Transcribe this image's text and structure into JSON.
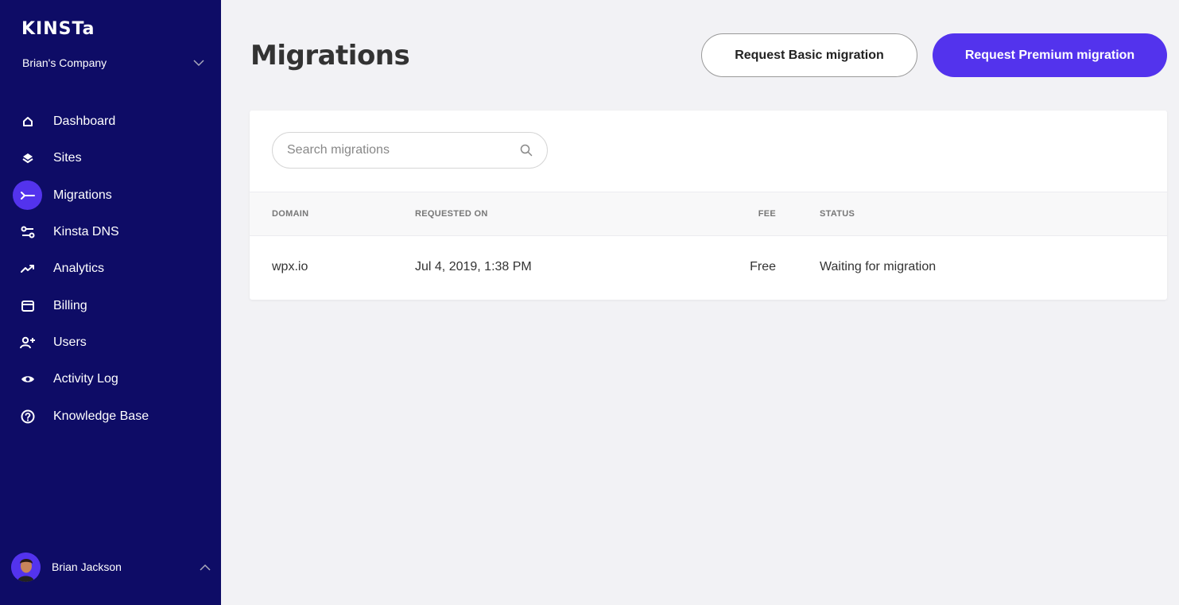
{
  "sidebar": {
    "logo": "KINSTa",
    "company": "Brian's Company",
    "items": [
      {
        "label": "Dashboard",
        "icon": "home-icon"
      },
      {
        "label": "Sites",
        "icon": "layers-icon"
      },
      {
        "label": "Migrations",
        "icon": "migration-icon",
        "active": true
      },
      {
        "label": "Kinsta DNS",
        "icon": "dns-icon"
      },
      {
        "label": "Analytics",
        "icon": "trend-icon"
      },
      {
        "label": "Billing",
        "icon": "card-icon"
      },
      {
        "label": "Users",
        "icon": "add-user-icon"
      },
      {
        "label": "Activity Log",
        "icon": "eye-icon"
      },
      {
        "label": "Knowledge Base",
        "icon": "help-icon"
      }
    ],
    "user": {
      "name": "Brian Jackson"
    }
  },
  "header": {
    "title": "Migrations",
    "basic_button": "Request Basic migration",
    "premium_button": "Request Premium migration"
  },
  "search": {
    "placeholder": "Search migrations",
    "value": ""
  },
  "table": {
    "headers": {
      "domain": "DOMAIN",
      "requested": "REQUESTED ON",
      "fee": "FEE",
      "status": "STATUS"
    },
    "rows": [
      {
        "domain": "wpx.io",
        "requested": "Jul 4, 2019, 1:38 PM",
        "fee": "Free",
        "status": "Waiting for migration"
      }
    ]
  },
  "colors": {
    "sidebar": "#0e0c66",
    "accent": "#5333ed",
    "background": "#f2f2f5"
  }
}
